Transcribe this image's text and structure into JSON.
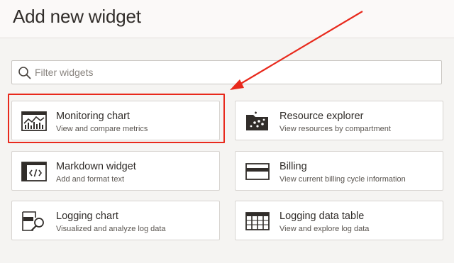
{
  "title": "Add new widget",
  "search": {
    "placeholder": "Filter widgets",
    "value": ""
  },
  "widgets": [
    {
      "name": "Monitoring chart",
      "description": "View and compare metrics",
      "icon": "monitoring-chart-icon"
    },
    {
      "name": "Resource explorer",
      "description": "View resources by compartment",
      "icon": "resource-explorer-icon"
    },
    {
      "name": "Markdown widget",
      "description": "Add and format text",
      "icon": "markdown-icon"
    },
    {
      "name": "Billing",
      "description": "View current billing cycle information",
      "icon": "billing-card-icon"
    },
    {
      "name": "Logging chart",
      "description": "Visualized and analyze log data",
      "icon": "logging-chart-icon"
    },
    {
      "name": "Logging data table",
      "description": "View and explore log data",
      "icon": "logging-table-icon"
    }
  ],
  "annotation": {
    "highlighted_widget": "Monitoring chart",
    "color": "#e8291c"
  },
  "colors": {
    "background": "#f5f4f2",
    "card": "#ffffff",
    "text": "#312d2a",
    "annotation": "#e8291c"
  }
}
